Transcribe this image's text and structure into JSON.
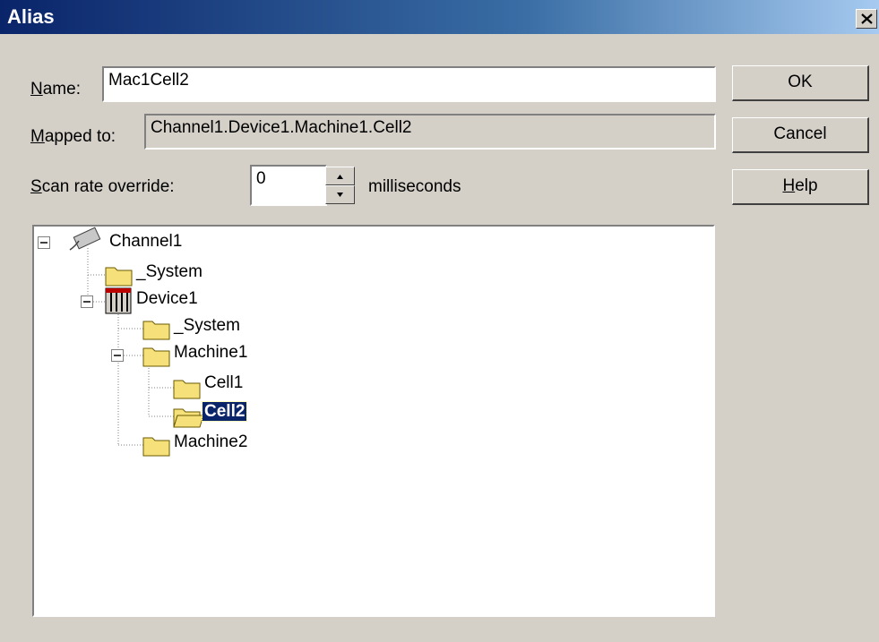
{
  "window": {
    "title": "Alias"
  },
  "form": {
    "name_label_prefix": "N",
    "name_label_rest": "ame:",
    "name_value": "Mac1Cell2",
    "mapped_label_prefix": "M",
    "mapped_label_rest": "apped to:",
    "mapped_value": "Channel1.Device1.Machine1.Cell2",
    "scan_label_prefix": "S",
    "scan_label_rest": "can rate override:",
    "scan_value": "0",
    "scan_unit": "milliseconds"
  },
  "buttons": {
    "ok": "OK",
    "cancel": "Cancel",
    "help_prefix": "H",
    "help_rest": "elp"
  },
  "tree": {
    "channel1": "Channel1",
    "system1": "_System",
    "device1": "Device1",
    "system2": "_System",
    "machine1": "Machine1",
    "cell1": "Cell1",
    "cell2": "Cell2",
    "machine2": "Machine2",
    "selected": "Cell2"
  },
  "colors": {
    "selection": "#0a246a",
    "title_gradient_start": "#0a246a",
    "title_gradient_end": "#a6caf0",
    "folder": "#f5e07a"
  }
}
